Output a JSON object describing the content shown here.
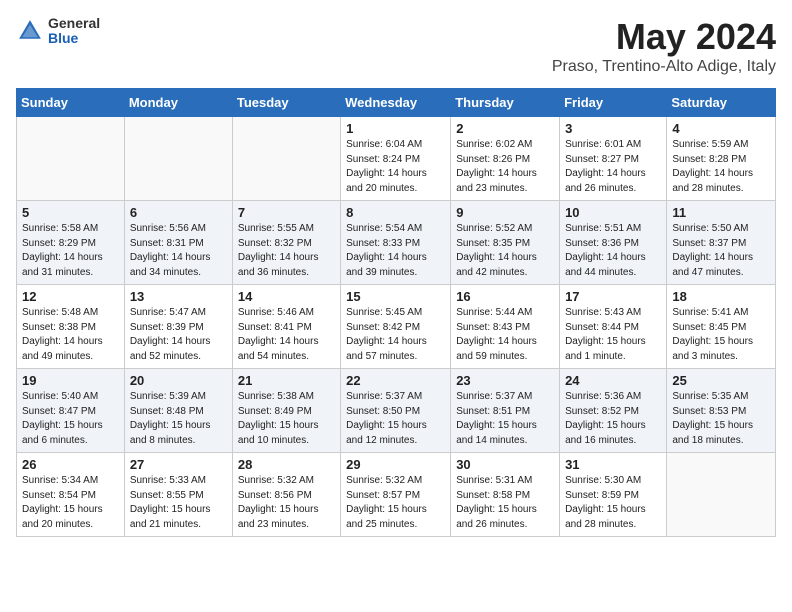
{
  "logo": {
    "general": "General",
    "blue": "Blue"
  },
  "title": "May 2024",
  "location": "Praso, Trentino-Alto Adige, Italy",
  "days_of_week": [
    "Sunday",
    "Monday",
    "Tuesday",
    "Wednesday",
    "Thursday",
    "Friday",
    "Saturday"
  ],
  "weeks": [
    [
      {
        "day": "",
        "info": ""
      },
      {
        "day": "",
        "info": ""
      },
      {
        "day": "",
        "info": ""
      },
      {
        "day": "1",
        "info": "Sunrise: 6:04 AM\nSunset: 8:24 PM\nDaylight: 14 hours\nand 20 minutes."
      },
      {
        "day": "2",
        "info": "Sunrise: 6:02 AM\nSunset: 8:26 PM\nDaylight: 14 hours\nand 23 minutes."
      },
      {
        "day": "3",
        "info": "Sunrise: 6:01 AM\nSunset: 8:27 PM\nDaylight: 14 hours\nand 26 minutes."
      },
      {
        "day": "4",
        "info": "Sunrise: 5:59 AM\nSunset: 8:28 PM\nDaylight: 14 hours\nand 28 minutes."
      }
    ],
    [
      {
        "day": "5",
        "info": "Sunrise: 5:58 AM\nSunset: 8:29 PM\nDaylight: 14 hours\nand 31 minutes."
      },
      {
        "day": "6",
        "info": "Sunrise: 5:56 AM\nSunset: 8:31 PM\nDaylight: 14 hours\nand 34 minutes."
      },
      {
        "day": "7",
        "info": "Sunrise: 5:55 AM\nSunset: 8:32 PM\nDaylight: 14 hours\nand 36 minutes."
      },
      {
        "day": "8",
        "info": "Sunrise: 5:54 AM\nSunset: 8:33 PM\nDaylight: 14 hours\nand 39 minutes."
      },
      {
        "day": "9",
        "info": "Sunrise: 5:52 AM\nSunset: 8:35 PM\nDaylight: 14 hours\nand 42 minutes."
      },
      {
        "day": "10",
        "info": "Sunrise: 5:51 AM\nSunset: 8:36 PM\nDaylight: 14 hours\nand 44 minutes."
      },
      {
        "day": "11",
        "info": "Sunrise: 5:50 AM\nSunset: 8:37 PM\nDaylight: 14 hours\nand 47 minutes."
      }
    ],
    [
      {
        "day": "12",
        "info": "Sunrise: 5:48 AM\nSunset: 8:38 PM\nDaylight: 14 hours\nand 49 minutes."
      },
      {
        "day": "13",
        "info": "Sunrise: 5:47 AM\nSunset: 8:39 PM\nDaylight: 14 hours\nand 52 minutes."
      },
      {
        "day": "14",
        "info": "Sunrise: 5:46 AM\nSunset: 8:41 PM\nDaylight: 14 hours\nand 54 minutes."
      },
      {
        "day": "15",
        "info": "Sunrise: 5:45 AM\nSunset: 8:42 PM\nDaylight: 14 hours\nand 57 minutes."
      },
      {
        "day": "16",
        "info": "Sunrise: 5:44 AM\nSunset: 8:43 PM\nDaylight: 14 hours\nand 59 minutes."
      },
      {
        "day": "17",
        "info": "Sunrise: 5:43 AM\nSunset: 8:44 PM\nDaylight: 15 hours\nand 1 minute."
      },
      {
        "day": "18",
        "info": "Sunrise: 5:41 AM\nSunset: 8:45 PM\nDaylight: 15 hours\nand 3 minutes."
      }
    ],
    [
      {
        "day": "19",
        "info": "Sunrise: 5:40 AM\nSunset: 8:47 PM\nDaylight: 15 hours\nand 6 minutes."
      },
      {
        "day": "20",
        "info": "Sunrise: 5:39 AM\nSunset: 8:48 PM\nDaylight: 15 hours\nand 8 minutes."
      },
      {
        "day": "21",
        "info": "Sunrise: 5:38 AM\nSunset: 8:49 PM\nDaylight: 15 hours\nand 10 minutes."
      },
      {
        "day": "22",
        "info": "Sunrise: 5:37 AM\nSunset: 8:50 PM\nDaylight: 15 hours\nand 12 minutes."
      },
      {
        "day": "23",
        "info": "Sunrise: 5:37 AM\nSunset: 8:51 PM\nDaylight: 15 hours\nand 14 minutes."
      },
      {
        "day": "24",
        "info": "Sunrise: 5:36 AM\nSunset: 8:52 PM\nDaylight: 15 hours\nand 16 minutes."
      },
      {
        "day": "25",
        "info": "Sunrise: 5:35 AM\nSunset: 8:53 PM\nDaylight: 15 hours\nand 18 minutes."
      }
    ],
    [
      {
        "day": "26",
        "info": "Sunrise: 5:34 AM\nSunset: 8:54 PM\nDaylight: 15 hours\nand 20 minutes."
      },
      {
        "day": "27",
        "info": "Sunrise: 5:33 AM\nSunset: 8:55 PM\nDaylight: 15 hours\nand 21 minutes."
      },
      {
        "day": "28",
        "info": "Sunrise: 5:32 AM\nSunset: 8:56 PM\nDaylight: 15 hours\nand 23 minutes."
      },
      {
        "day": "29",
        "info": "Sunrise: 5:32 AM\nSunset: 8:57 PM\nDaylight: 15 hours\nand 25 minutes."
      },
      {
        "day": "30",
        "info": "Sunrise: 5:31 AM\nSunset: 8:58 PM\nDaylight: 15 hours\nand 26 minutes."
      },
      {
        "day": "31",
        "info": "Sunrise: 5:30 AM\nSunset: 8:59 PM\nDaylight: 15 hours\nand 28 minutes."
      },
      {
        "day": "",
        "info": ""
      }
    ]
  ]
}
